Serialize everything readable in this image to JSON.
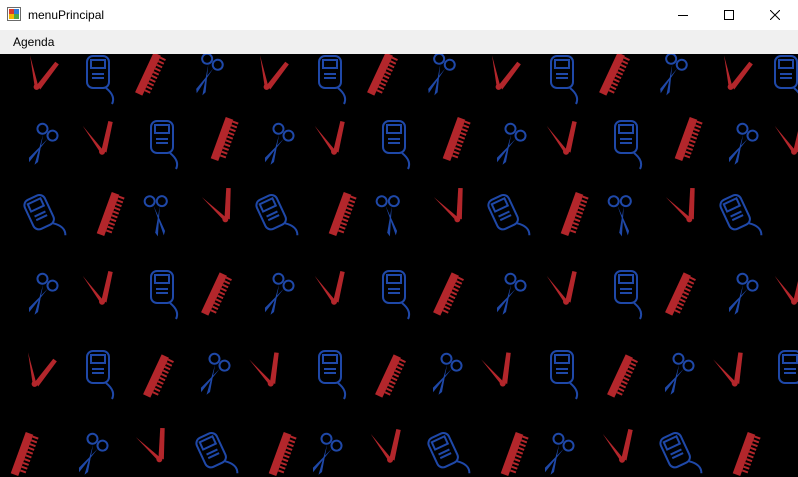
{
  "window": {
    "title": "menuPrincipal",
    "icon": "form-icon",
    "controls": {
      "minimize_icon": "minimize-icon",
      "maximize_icon": "maximize-icon",
      "close_icon": "close-icon"
    }
  },
  "menu": {
    "items": [
      {
        "label": "Agenda"
      }
    ]
  },
  "background": {
    "description_icons": [
      "scissors-icon",
      "razor-icon",
      "comb-icon",
      "clipper-icon"
    ],
    "colors": {
      "red": "#b3262b",
      "blue": "#1f48a8",
      "base": "#000000"
    }
  }
}
